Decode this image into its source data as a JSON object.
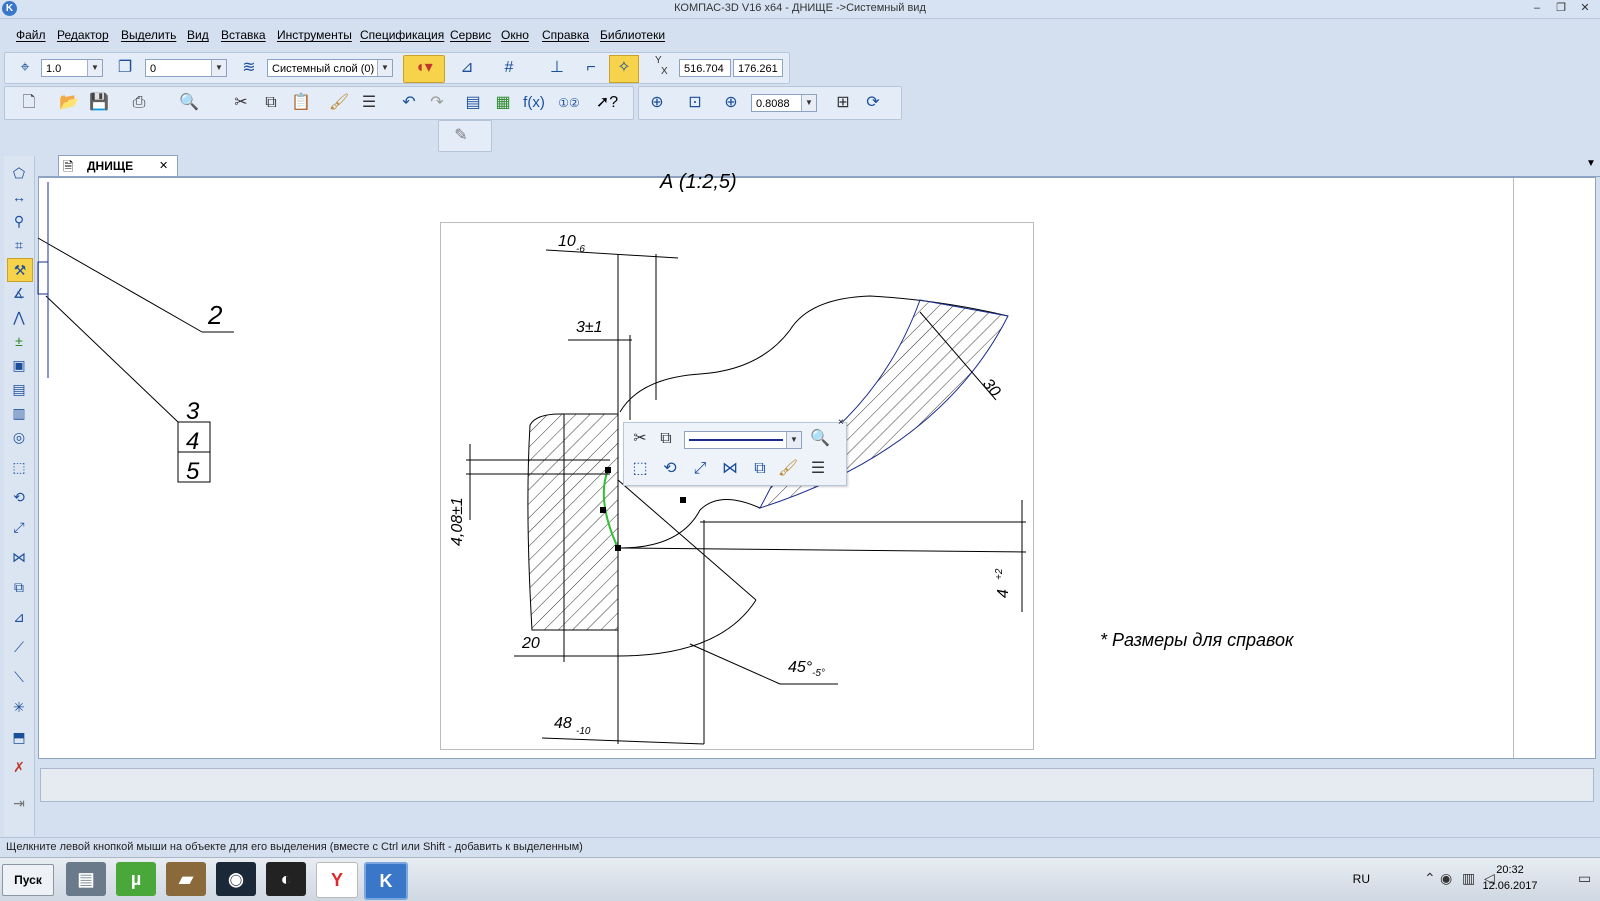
{
  "app": {
    "title": "КОМПАС-3D V16  x64 - ДНИЩЕ ->Системный вид",
    "logo_letter": "K"
  },
  "window_controls": {
    "minimize": "–",
    "restore": "❐",
    "close": "✕"
  },
  "menu": [
    "Файл",
    "Редактор",
    "Выделить",
    "Вид",
    "Вставка",
    "Инструменты",
    "Спецификация",
    "Сервис",
    "Окно",
    "Справка",
    "Библиотеки"
  ],
  "toolbar1": {
    "step_value": "1.0",
    "view_value": "0",
    "layer_value": "Системный слой (0)",
    "coord_y": "516.704",
    "coord_x": "176.261",
    "yx_label_y": "Y",
    "yx_label_x": "X"
  },
  "toolbar2": {
    "zoom_value": "0.8088",
    "fx_label": "f(x)"
  },
  "document_tab": {
    "label": "ДНИЩЕ",
    "close": "✕"
  },
  "drawing": {
    "partial_top_text": "А (1:2,5)",
    "leader_labels": [
      "2",
      "3",
      "4",
      "5"
    ],
    "dim_10": "10",
    "dim_10_tol": "-6",
    "dim_3": "3±1",
    "dim_408": "4,08±1",
    "dim_20": "20",
    "dim_48": "48",
    "dim_48_tol": "-10",
    "dim_45": "45°",
    "dim_45_tol": "-5°",
    "dim_30": "30",
    "dim_4": "4",
    "dim_4_tol": "+2",
    "note": "* Размеры для справок"
  },
  "status_text": "Щелкните левой кнопкой мыши на объекте для его выделения (вместе с Ctrl или Shift - добавить к выделенным)",
  "taskbar": {
    "start": "Пуск",
    "lang": "RU",
    "time": "20:32",
    "date": "12.06.2017"
  },
  "colors": {
    "accent_highlight": "#f7d24b",
    "selection_green": "#2fbf2f",
    "curve_blue": "#1b2e8f"
  }
}
